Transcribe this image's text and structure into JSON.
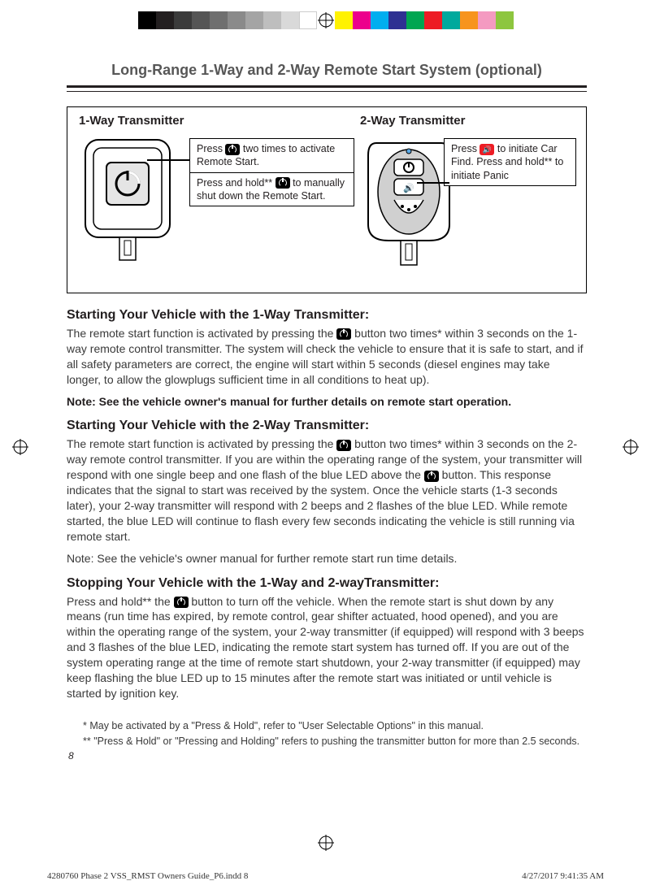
{
  "title": "Long-Range 1-Way and 2-Way Remote Start System (optional)",
  "diagram": {
    "oneWayLabel": "1-Way Transmitter",
    "twoWayLabel": "2-Way Transmitter",
    "callout1_line1a": "Press ",
    "callout1_line1b": " two times to activate Remote Start.",
    "callout1_line2a": "Press and hold**  ",
    "callout1_line2b": " to manually shut down the Remote Start.",
    "callout2_a": "Press ",
    "callout2_b": " to initiate Car Find. Press and hold** to initiate Panic"
  },
  "sections": {
    "h1": "Starting Your Vehicle with the 1-Way Transmitter:",
    "p1a": "The remote start function is activated by pressing the ",
    "p1b": " button two times* within 3 seconds on the 1-way remote control transmitter.  The system will check the vehicle to ensure that it is safe to start, and if all safety parameters are correct, the engine will start within 5 seconds (diesel engines may take longer, to allow the glowplugs sufficient time in all conditions to heat up).",
    "note1": "Note: See the vehicle owner's manual for further details on remote start operation.",
    "h2": "Starting Your Vehicle with the 2-Way Transmitter:",
    "p2a": "The remote start function is activated by pressing the ",
    "p2b": " button two times* within 3 seconds on the 2-way remote control transmitter. If you are within the operating range of the system, your transmitter will respond with one single beep and one flash of the blue LED above  the ",
    "p2c": " button. This response indicates that the signal to start was received by the system. Once the vehicle starts (1-3 seconds later), your 2-way transmitter will respond with 2 beeps and 2 flashes of the blue LED.  While remote started, the blue LED will continue to flash every few seconds indicating the vehicle is still running via remote start.",
    "note2": "Note: See the vehicle's owner manual for further remote start run time details.",
    "h3": "Stopping Your Vehicle with the 1-Way and 2-wayTransmitter:",
    "p3a": "Press and hold** the  ",
    "p3b": "  button to turn off the vehicle.  When the remote start is shut down by any means (run time has expired, by remote control, gear shifter actuated, hood opened), and you are within the operating range of the system, your 2-way transmitter (if equipped) will respond with 3 beeps and 3 flashes of the blue LED, indicating the remote start system has turned off.  If you are out of the system operating range at the time of remote start shutdown, your 2-way transmitter (if equipped) may keep flashing the blue LED up to 15 minutes after the remote start was initiated or until vehicle is started by ignition key."
  },
  "footnotes": {
    "f1": "*  May be activated by a \"Press & Hold\", refer to \"User Selectable Options\" in this manual.",
    "f2": "** \"Press & Hold\" or \"Pressing and Holding\" refers to pushing the transmitter button for more than 2.5 seconds."
  },
  "pgnum": "8",
  "footer": {
    "left": "4280760 Phase 2 VSS_RMST Owners Guide_P6.indd   8",
    "right": "4/27/2017   9:41:35 AM"
  },
  "printbar_colors": [
    "#000000",
    "#231f20",
    "#3b3b3b",
    "#555555",
    "#6f6f6f",
    "#8a8a8a",
    "#a4a4a4",
    "#bebebe",
    "#d9d9d9",
    "#ffffff",
    "#fff200",
    "#ec008c",
    "#00aeef",
    "#2e3192",
    "#00a651",
    "#ed1c24",
    "#00a99d",
    "#f7941d",
    "#f49ac1",
    "#8dc63f"
  ]
}
